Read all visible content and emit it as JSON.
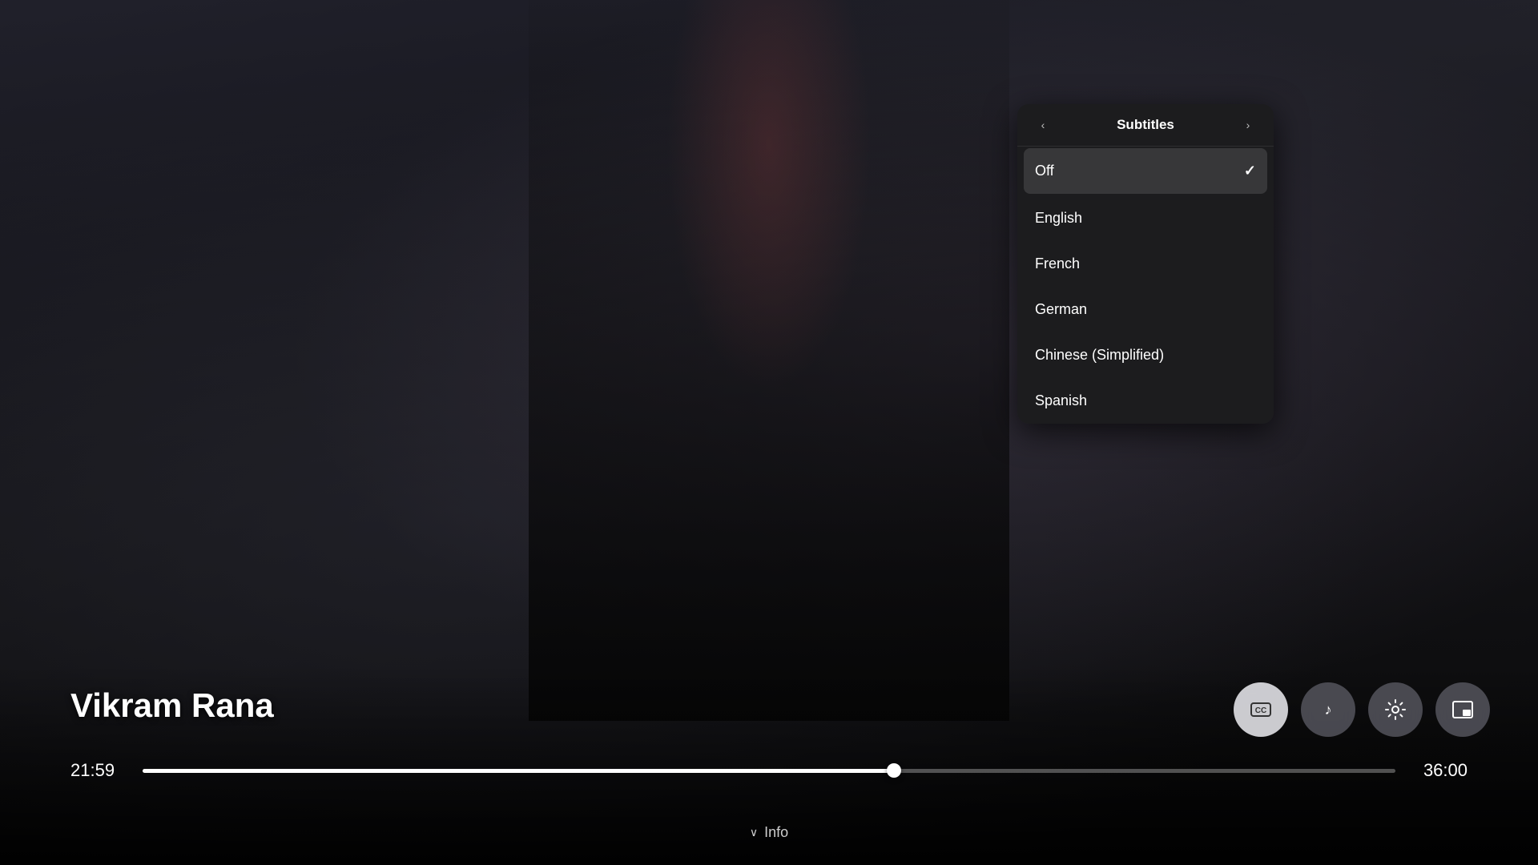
{
  "background": {
    "color": "#1a1a1a"
  },
  "subtitles_panel": {
    "title": "Subtitles",
    "nav_prev": "‹",
    "nav_next": "›",
    "options": [
      {
        "label": "Off",
        "selected": true
      },
      {
        "label": "English",
        "selected": false
      },
      {
        "label": "French",
        "selected": false
      },
      {
        "label": "German",
        "selected": false
      },
      {
        "label": "Chinese (Simplified)",
        "selected": false
      },
      {
        "label": "Spanish",
        "selected": false
      }
    ]
  },
  "player": {
    "title": "Vikram Rana",
    "time_current": "21:59",
    "time_total": "36:00",
    "progress_percent": 60
  },
  "controls": {
    "cc_label": "CC",
    "music_label": "♪",
    "settings_label": "⚙",
    "pip_label": "⧉"
  },
  "info_bar": {
    "chevron": "∨",
    "label": "Info"
  }
}
